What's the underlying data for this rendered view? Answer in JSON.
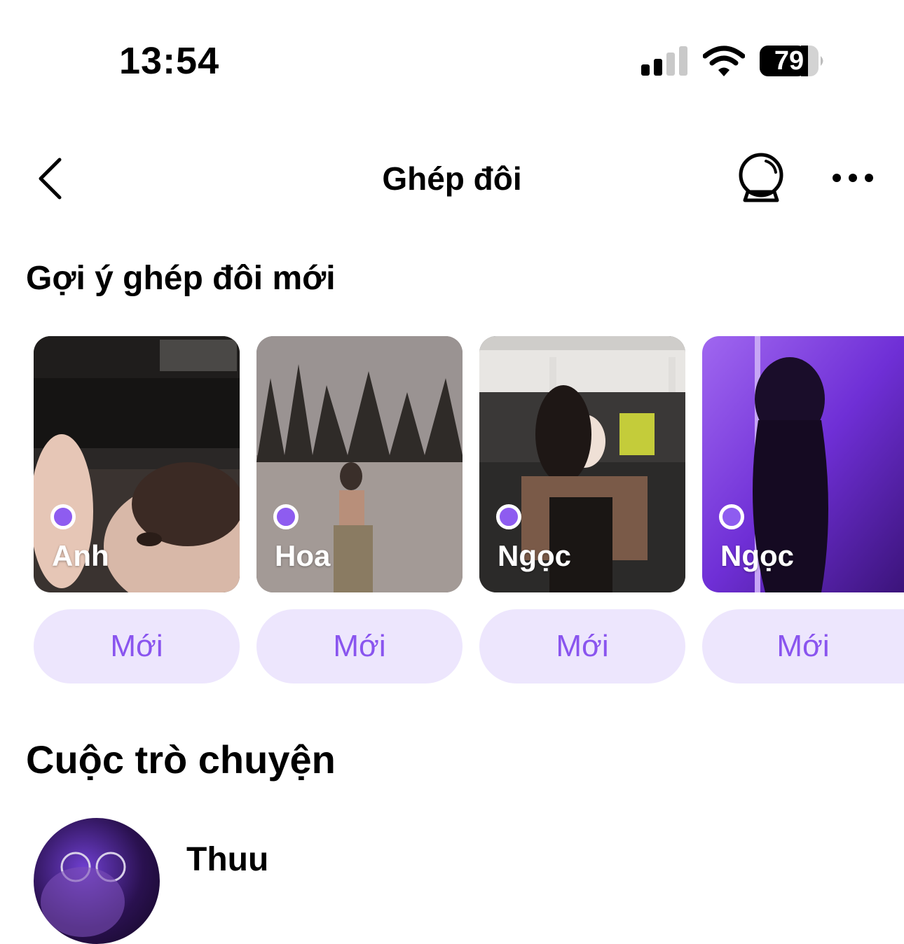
{
  "status_bar": {
    "time": "13:54",
    "battery": "79",
    "icons": [
      "signal-icon",
      "wifi-icon",
      "battery-icon"
    ]
  },
  "nav": {
    "title": "Ghép đôi",
    "icons": [
      "back-chevron-icon",
      "crystal-ball-icon",
      "more-dots-icon"
    ]
  },
  "suggestions": {
    "title": "Gợi ý ghép đôi mới",
    "cards": [
      {
        "name": "Anh",
        "badge": "Mới"
      },
      {
        "name": "Hoa",
        "badge": "Mới"
      },
      {
        "name": "Ngọc",
        "badge": "Mới"
      },
      {
        "name": "Ngọc",
        "badge": "Mới"
      }
    ]
  },
  "conversations": {
    "title": "Cuộc trò chuyện",
    "items": [
      {
        "name": "Thuu"
      }
    ]
  },
  "colors": {
    "accent": "#8a55ef",
    "pill_bg": "#ede6fd",
    "dot": "#8e5cf0"
  }
}
